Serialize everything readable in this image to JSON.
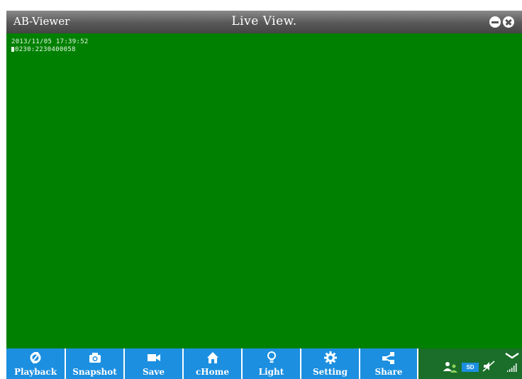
{
  "window": {
    "app_title": "AB-Viewer",
    "view_title": "Live View."
  },
  "video": {
    "timestamp": "2013/11/05 17:39:52",
    "camera_id": "0230:2230400058",
    "background_color": "#008000"
  },
  "toolbar": {
    "accent_color": "#1c8fe0",
    "buttons": [
      {
        "label": "Playback",
        "icon": "sync-icon"
      },
      {
        "label": "Snapshot",
        "icon": "camera-icon"
      },
      {
        "label": "Save",
        "icon": "video-camera-icon"
      },
      {
        "label": "cHome",
        "icon": "home-icon"
      },
      {
        "label": "Light",
        "icon": "lightbulb-icon"
      },
      {
        "label": "Setting",
        "icon": "gear-icon"
      },
      {
        "label": "Share",
        "icon": "share-icon"
      }
    ]
  },
  "status": {
    "sd_label": "SD",
    "users_icon": "users-icon",
    "mute_icon": "speaker-muted-icon",
    "signal_icon": "signal-bars-icon",
    "collapse_icon": "chevron-down-icon"
  }
}
